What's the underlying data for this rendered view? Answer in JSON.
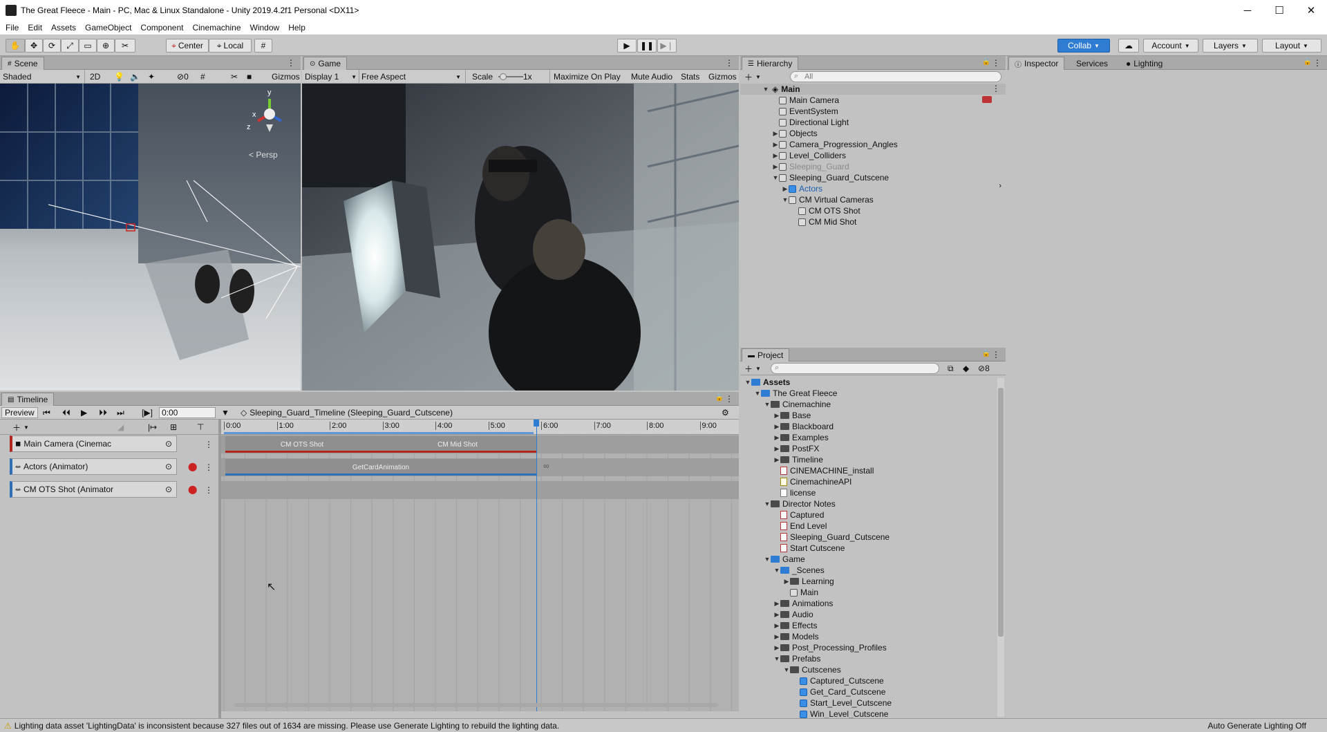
{
  "window": {
    "title": "The Great Fleece - Main - PC, Mac & Linux Standalone - Unity 2019.4.2f1 Personal <DX11>",
    "minimize": "─",
    "maximize": "☐",
    "close": "✕"
  },
  "menu": [
    "File",
    "Edit",
    "Assets",
    "GameObject",
    "Component",
    "Cinemachine",
    "Window",
    "Help"
  ],
  "toolbar": {
    "pivot": "Center",
    "space": "Local",
    "collab": "Collab",
    "account": "Account",
    "layers": "Layers",
    "layout": "Layout"
  },
  "scene": {
    "tab": "Scene",
    "shading": "Shaded",
    "mode2d": "2D",
    "hidden_count": "0",
    "gizmos": "Gizmos",
    "persp": "< Persp",
    "axis_y": "y",
    "axis_x": "x",
    "axis_z": "z"
  },
  "game": {
    "tab": "Game",
    "display": "Display 1",
    "aspect": "Free Aspect",
    "scale_label": "Scale",
    "scale_value": "1x",
    "maximize": "Maximize On Play",
    "mute": "Mute Audio",
    "stats": "Stats",
    "gizmos": "Gizmos"
  },
  "hierarchy": {
    "tab": "Hierarchy",
    "search_placeholder": "All",
    "scene_root": "Main",
    "items": [
      {
        "label": "Main Camera",
        "depth": 1,
        "arrow": "",
        "dim": false,
        "blue": false
      },
      {
        "label": "EventSystem",
        "depth": 1,
        "arrow": "",
        "dim": false,
        "blue": false
      },
      {
        "label": "Directional Light",
        "depth": 1,
        "arrow": "",
        "dim": false,
        "blue": false
      },
      {
        "label": "Objects",
        "depth": 1,
        "arrow": "▶",
        "dim": false,
        "blue": false
      },
      {
        "label": "Camera_Progression_Angles",
        "depth": 1,
        "arrow": "▶",
        "dim": false,
        "blue": false
      },
      {
        "label": "Level_Colliders",
        "depth": 1,
        "arrow": "▶",
        "dim": false,
        "blue": false
      },
      {
        "label": "Sleeping_Guard",
        "depth": 1,
        "arrow": "▶",
        "dim": true,
        "blue": false
      },
      {
        "label": "Sleeping_Guard_Cutscene",
        "depth": 1,
        "arrow": "▼",
        "dim": false,
        "blue": false
      },
      {
        "label": "Actors",
        "depth": 2,
        "arrow": "▶",
        "dim": false,
        "blue": true
      },
      {
        "label": "CM Virtual Cameras",
        "depth": 2,
        "arrow": "▼",
        "dim": false,
        "blue": false
      },
      {
        "label": "CM OTS Shot",
        "depth": 3,
        "arrow": "",
        "dim": false,
        "blue": false
      },
      {
        "label": "CM Mid Shot",
        "depth": 3,
        "arrow": "",
        "dim": false,
        "blue": false
      }
    ]
  },
  "inspector_tabs": [
    "Inspector",
    "Services",
    "Lighting"
  ],
  "project": {
    "tab": "Project",
    "hidden_count": "8",
    "items": [
      {
        "label": "Assets",
        "depth": 0,
        "arrow": "▼",
        "icon": "folder-blue",
        "bold": true
      },
      {
        "label": "The Great Fleece",
        "depth": 1,
        "arrow": "▼",
        "icon": "folder-blue"
      },
      {
        "label": "Cinemachine",
        "depth": 2,
        "arrow": "▼",
        "icon": "folder"
      },
      {
        "label": "Base",
        "depth": 3,
        "arrow": "▶",
        "icon": "folder"
      },
      {
        "label": "Blackboard",
        "depth": 3,
        "arrow": "▶",
        "icon": "folder"
      },
      {
        "label": "Examples",
        "depth": 3,
        "arrow": "▶",
        "icon": "folder"
      },
      {
        "label": "PostFX",
        "depth": 3,
        "arrow": "▶",
        "icon": "folder"
      },
      {
        "label": "Timeline",
        "depth": 3,
        "arrow": "▶",
        "icon": "folder"
      },
      {
        "label": "CINEMACHINE_install",
        "depth": 3,
        "arrow": "",
        "icon": "doc"
      },
      {
        "label": "CinemachineAPI",
        "depth": 3,
        "arrow": "",
        "icon": "csharp"
      },
      {
        "label": "license",
        "depth": 3,
        "arrow": "",
        "icon": "text"
      },
      {
        "label": "Director Notes",
        "depth": 2,
        "arrow": "▼",
        "icon": "folder"
      },
      {
        "label": "Captured",
        "depth": 3,
        "arrow": "",
        "icon": "doc"
      },
      {
        "label": "End Level",
        "depth": 3,
        "arrow": "",
        "icon": "doc"
      },
      {
        "label": "Sleeping_Guard_Cutscene",
        "depth": 3,
        "arrow": "",
        "icon": "doc"
      },
      {
        "label": "Start Cutscene",
        "depth": 3,
        "arrow": "",
        "icon": "doc"
      },
      {
        "label": "Game",
        "depth": 2,
        "arrow": "▼",
        "icon": "folder-blue"
      },
      {
        "label": "_Scenes",
        "depth": 3,
        "arrow": "▼",
        "icon": "folder-blue"
      },
      {
        "label": "Learning",
        "depth": 4,
        "arrow": "▶",
        "icon": "folder"
      },
      {
        "label": "Main",
        "depth": 4,
        "arrow": "",
        "icon": "scene"
      },
      {
        "label": "Animations",
        "depth": 3,
        "arrow": "▶",
        "icon": "folder"
      },
      {
        "label": "Audio",
        "depth": 3,
        "arrow": "▶",
        "icon": "folder"
      },
      {
        "label": "Effects",
        "depth": 3,
        "arrow": "▶",
        "icon": "folder"
      },
      {
        "label": "Models",
        "depth": 3,
        "arrow": "▶",
        "icon": "folder"
      },
      {
        "label": "Post_Processing_Profiles",
        "depth": 3,
        "arrow": "▶",
        "icon": "folder"
      },
      {
        "label": "Prefabs",
        "depth": 3,
        "arrow": "▼",
        "icon": "folder"
      },
      {
        "label": "Cutscenes",
        "depth": 4,
        "arrow": "▼",
        "icon": "folder"
      },
      {
        "label": "Captured_Cutscene",
        "depth": 5,
        "arrow": "",
        "icon": "prefab"
      },
      {
        "label": "Get_Card_Cutscene",
        "depth": 5,
        "arrow": "",
        "icon": "prefab"
      },
      {
        "label": "Start_Level_Cutscene",
        "depth": 5,
        "arrow": "",
        "icon": "prefab"
      },
      {
        "label": "Win_Level_Cutscene",
        "depth": 5,
        "arrow": "",
        "icon": "prefab"
      }
    ]
  },
  "timeline": {
    "tab": "Timeline",
    "preview": "Preview",
    "time": "0:00",
    "asset": "Sleeping_Guard_Timeline (Sleeping_Guard_Cutscene)",
    "ruler": [
      "0:00",
      "1:00",
      "2:00",
      "3:00",
      "4:00",
      "5:00",
      "6:00",
      "7:00",
      "8:00",
      "9:00"
    ],
    "tracks": [
      {
        "label": "Main Camera (Cinemac"
      },
      {
        "label": "Actors (Animator)"
      },
      {
        "label": "CM OTS Shot (Animator"
      }
    ],
    "clips": {
      "ots": "CM OTS Shot",
      "mid": "CM Mid Shot",
      "anim": "GetCardAnimation"
    }
  },
  "status": {
    "warning": "Lighting data asset 'LightingData' is inconsistent because 327 files out of 1634 are missing.  Please use Generate Lighting to rebuild the lighting data.",
    "auto_lighting": "Auto Generate Lighting Off"
  },
  "colors": {
    "accent": "#2f7cd3",
    "cinemachine_track": "#b3261e",
    "animation_track": "#2f6fb5",
    "panel_bg": "#c2c2c2"
  }
}
